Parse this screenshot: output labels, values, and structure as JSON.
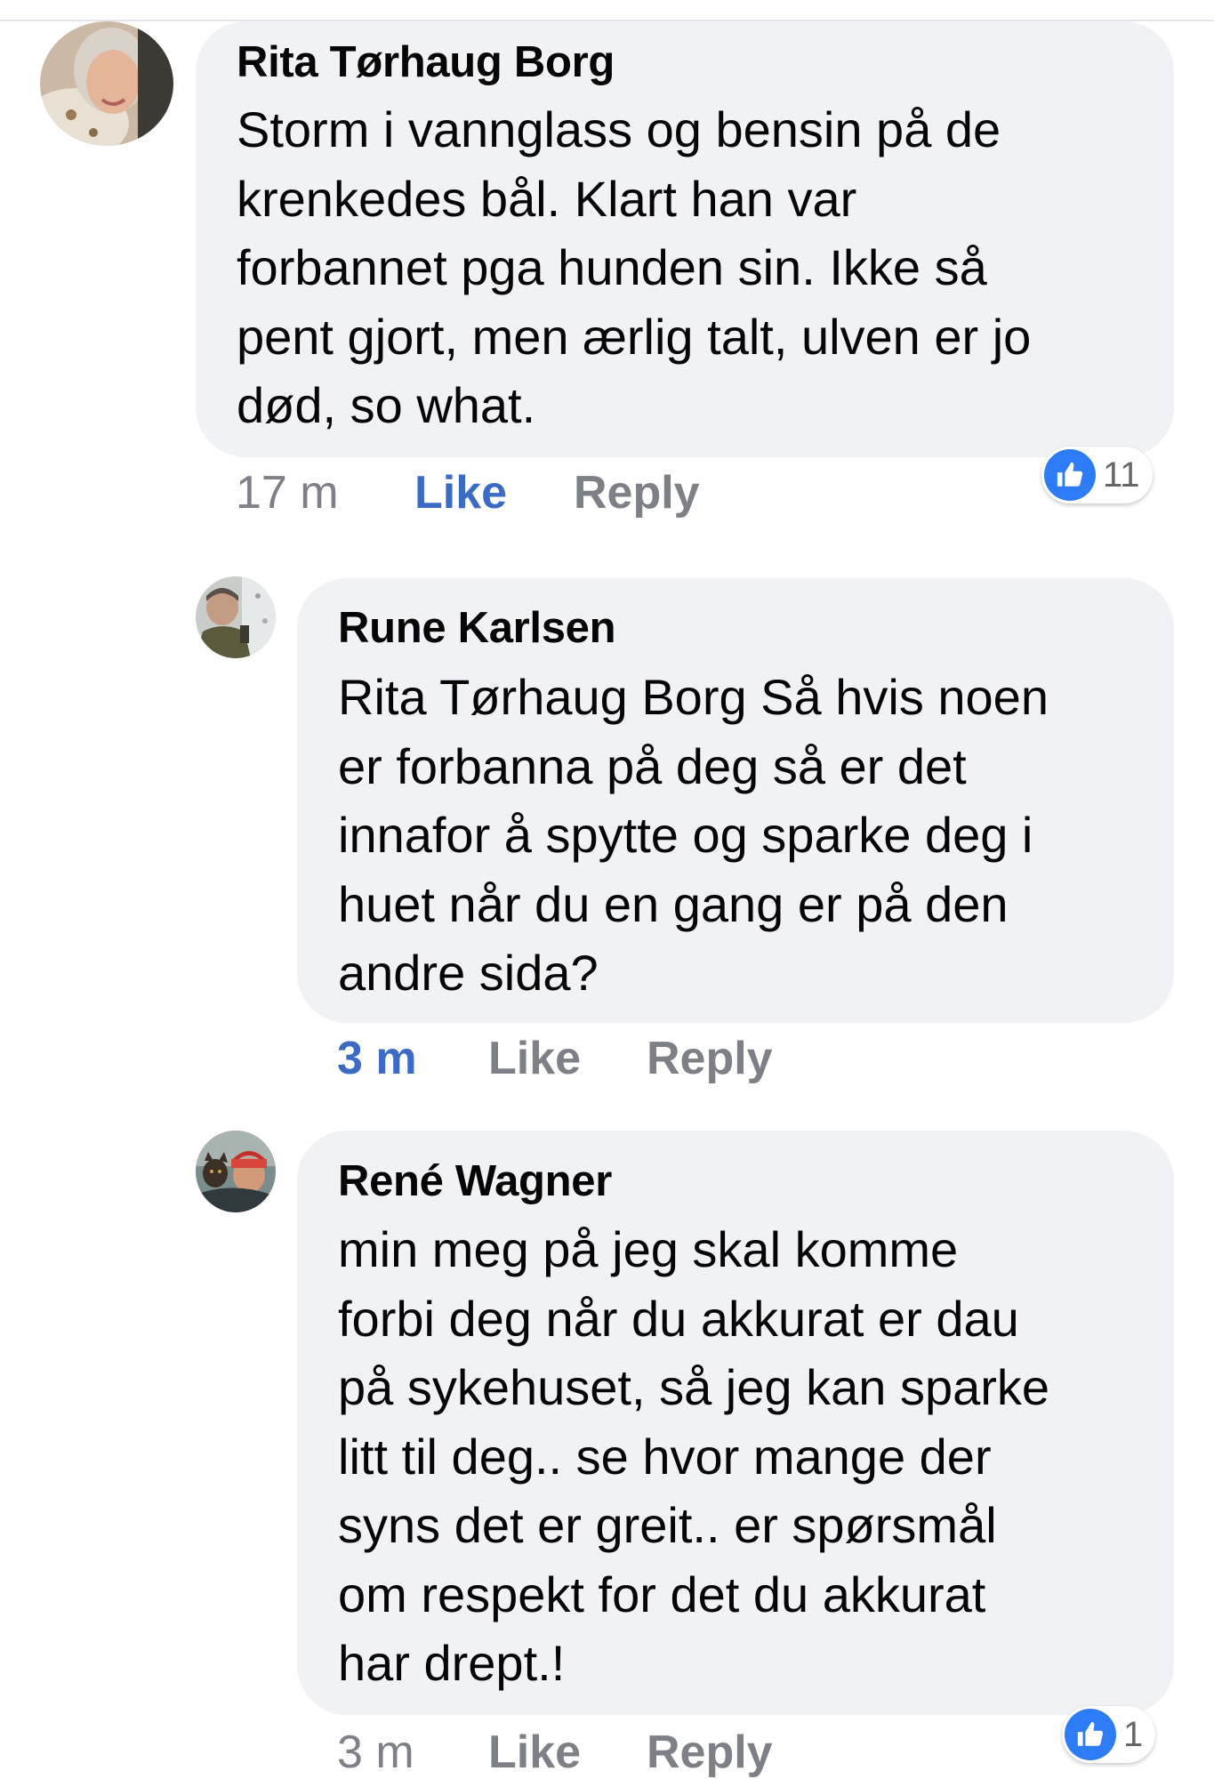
{
  "comments": [
    {
      "author": "Rita Tørhaug Borg",
      "text": "Storm i vannglass og bensin på de\nkrenkedes bål. Klart han var\nforbannet pga hunden sin. Ikke så\npent gjort, men ærlig talt, ulven er jo\ndød, so what.",
      "time": "17 m",
      "like_label": "Like",
      "reply_label": "Reply",
      "like_active": true,
      "reaction_count": "11"
    },
    {
      "author": "Rune Karlsen",
      "text": "Rita Tørhaug Borg Så hvis noen\ner forbanna på deg så er det\ninnafor å spytte og sparke deg i\nhuet når du en gang er på den\nandre sida?",
      "time": "3 m",
      "like_label": "Like",
      "reply_label": "Reply",
      "time_active": true
    },
    {
      "author": "René Wagner",
      "text": "min meg på jeg skal komme\nforbi deg når du akkurat er dau\npå sykehuset, så jeg kan sparke\nlitt til deg.. se hvor mange der\nsyns det er greit.. er spørsmål\nom respekt for det du akkurat\nhar drept.!",
      "time": "3 m",
      "like_label": "Like",
      "reply_label": "Reply",
      "reaction_count": "1"
    }
  ],
  "colors": {
    "bubble": "#f0f2f5",
    "link_blue": "#3b6bc4",
    "meta_gray": "#7d8087",
    "like_blue": "#2d7cf6"
  },
  "icons": {
    "reaction": "thumbs-up-icon"
  }
}
